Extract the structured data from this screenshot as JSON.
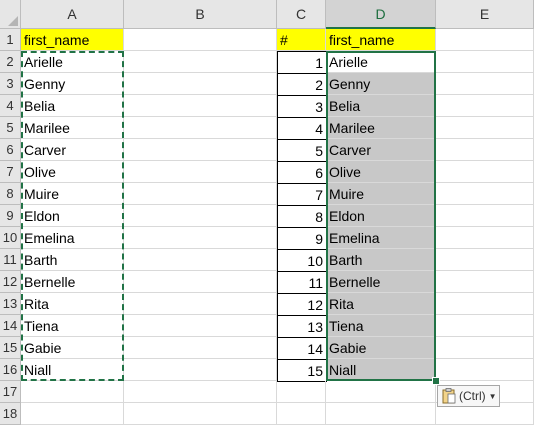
{
  "columns": [
    "A",
    "B",
    "C",
    "D",
    "E"
  ],
  "rows": [
    "1",
    "2",
    "3",
    "4",
    "5",
    "6",
    "7",
    "8",
    "9",
    "10",
    "11",
    "12",
    "13",
    "14",
    "15",
    "16",
    "17",
    "18"
  ],
  "cells": {
    "A1": "first_name",
    "C1": "#",
    "D1": "first_name"
  },
  "names": [
    "Arielle",
    "Genny",
    "Belia",
    "Marilee",
    "Carver",
    "Olive",
    "Muire",
    "Eldon",
    "Emelina",
    "Barth",
    "Bernelle",
    "Rita",
    "Tiena",
    "Gabie",
    "Niall"
  ],
  "numbers": [
    "1",
    "2",
    "3",
    "4",
    "5",
    "6",
    "7",
    "8",
    "9",
    "10",
    "11",
    "12",
    "13",
    "14",
    "15"
  ],
  "paste_options": {
    "label": "(Ctrl)",
    "icon": "clipboard-icon"
  },
  "colors": {
    "header_fill": "#ffff00",
    "selection": "#217346",
    "pasted_fill": "#c8c8c8"
  }
}
